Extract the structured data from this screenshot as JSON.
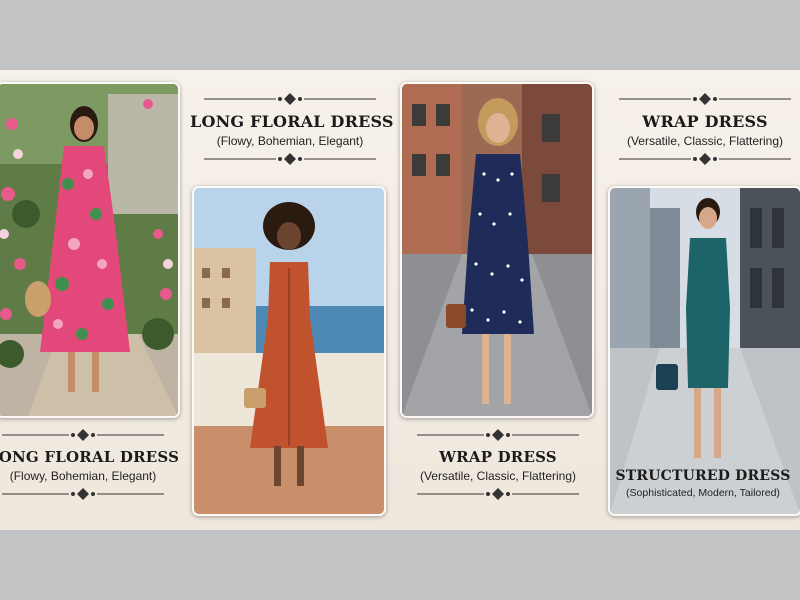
{
  "labels": {
    "top_left": {
      "title": "LONG FLORAL DRESS",
      "subtitle": "(Flowy, Bohemian, Elegant)"
    },
    "top_right": {
      "title": "WRAP DRESS",
      "subtitle": "(Versatile, Classic, Flattering)"
    },
    "bottom_left": {
      "title": "LONG FLORAL DRESS",
      "subtitle": "(Flowy, Bohemian, Elegant)"
    },
    "bottom_center": {
      "title": "WRAP DRESS",
      "subtitle": "(Versatile, Classic, Flattering)"
    },
    "bottom_right": {
      "title": "STRUCTURED DRESS",
      "subtitle": "(Sophisticated, Modern, Tailored)"
    }
  },
  "photos": [
    {
      "name": "floral-dress-garden-photo",
      "dress_color": "#e2497a"
    },
    {
      "name": "button-sundress-seaside-photo",
      "dress_color": "#c0532e"
    },
    {
      "name": "polka-dot-wrap-dress-street-photo",
      "dress_color": "#1f2c5a"
    },
    {
      "name": "teal-sheath-dress-city-photo",
      "dress_color": "#1d6468"
    }
  ],
  "colors": {
    "background": "#c2c3c5",
    "panel": "#f4eee6",
    "text": "#1b1b1b"
  }
}
